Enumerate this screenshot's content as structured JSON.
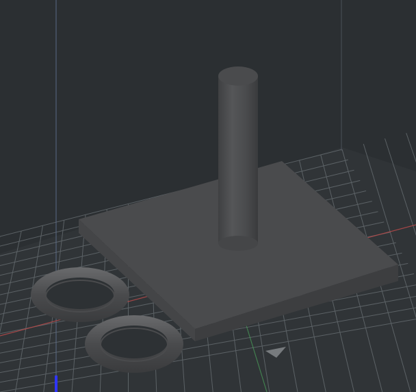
{
  "app": {
    "view": "3d-viewport",
    "projection": "perspective"
  },
  "scene": {
    "background_color": "#2b2f32",
    "grid_color": "#6b7276",
    "bed_fill_color": "#3a3f43",
    "axis_colors": {
      "x": "#b84a4a",
      "y": "#4aa05a",
      "z": "#2f35ff"
    },
    "objects": [
      {
        "name": "base-plate-with-peg",
        "shape": "square plate with vertical cylinder peg",
        "color": "#4a4b4d"
      },
      {
        "name": "ring-1",
        "shape": "torus",
        "color": "#5a5b5d"
      },
      {
        "name": "ring-2",
        "shape": "torus",
        "color": "#5a5b5d"
      }
    ]
  }
}
